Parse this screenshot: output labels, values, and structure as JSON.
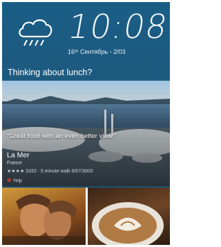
{
  "clock": {
    "time": "10:08",
    "date": "16ᵗʰ Сентябрь - 2/03",
    "weather_icon": "cloud-rain-icon"
  },
  "feed": {
    "banner_title": "Thinking about lunch?",
    "card": {
      "quote": "“Great food with an even better view!”",
      "name": "La Mer",
      "region": "France",
      "rating_text": "★★★★ 3333 · 5 minute walk 6/07/3000",
      "source": "Yelp"
    },
    "tiles": [
      "couple-photo",
      "latte-photo"
    ]
  },
  "colors": {
    "accent": "#1d5a80",
    "text": "#ffffff"
  }
}
